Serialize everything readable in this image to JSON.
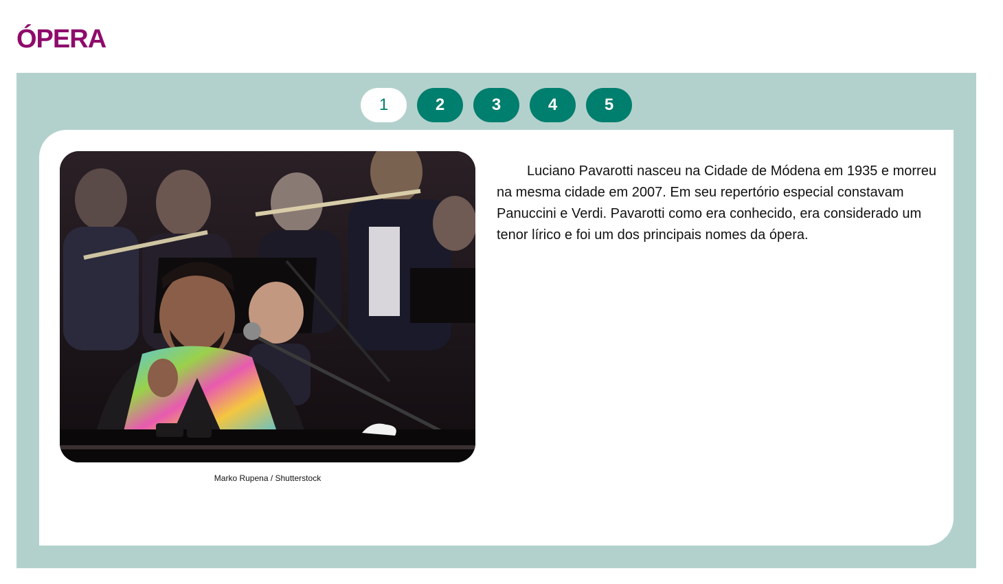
{
  "page": {
    "title": "ÓPERA"
  },
  "tabs": [
    {
      "label": "1",
      "active": true
    },
    {
      "label": "2",
      "active": false
    },
    {
      "label": "3",
      "active": false
    },
    {
      "label": "4",
      "active": false
    },
    {
      "label": "5",
      "active": false
    }
  ],
  "content": {
    "image_caption": "Marko Rupena / Shutterstock",
    "paragraph": "Luciano Pavarotti nasceu na Cidade de Módena em 1935 e morreu na mesma cidade em 2007. Em seu repertório especial constavam Panuccini e Verdi. Pavarotti como era conhecido, era considerado um tenor lírico e foi um dos principais nomes da ópera."
  },
  "colors": {
    "title": "#8e0b6b",
    "panel_bg": "#b3d1cc",
    "tab_bg": "#007e6e",
    "tab_active_bg": "#ffffff"
  }
}
